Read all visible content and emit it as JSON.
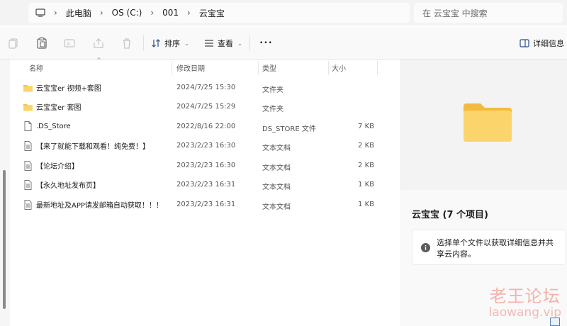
{
  "address": {
    "crumbs": [
      "此电脑",
      "OS (C:)",
      "001",
      "云宝宝"
    ],
    "search_placeholder": "在 云宝宝 中搜索"
  },
  "commands": {
    "sort_label": "排序",
    "view_label": "查看",
    "more_label": "•••",
    "details_label": "详细信息"
  },
  "columns": {
    "name": "名称",
    "modified": "修改日期",
    "type": "类型",
    "size": "大小"
  },
  "files": [
    {
      "name": "云宝宝er 视频+套图",
      "modified": "2024/7/25 15:30",
      "type": "文件夹",
      "size": "",
      "icon": "folder-icon"
    },
    {
      "name": "云宝宝er 套图",
      "modified": "2024/7/25 15:29",
      "type": "文件夹",
      "size": "",
      "icon": "folder-icon"
    },
    {
      "name": ".DS_Store",
      "modified": "2022/8/16 22:00",
      "type": "DS_STORE 文件",
      "size": "7 KB",
      "icon": "file-icon"
    },
    {
      "name": "【来了就能下载和观看！纯免费！】",
      "modified": "2023/2/23 16:30",
      "type": "文本文档",
      "size": "2 KB",
      "icon": "text-file-icon"
    },
    {
      "name": "【论坛介绍】",
      "modified": "2023/2/23 16:30",
      "type": "文本文档",
      "size": "2 KB",
      "icon": "text-file-icon"
    },
    {
      "name": "【永久地址发布页】",
      "modified": "2023/2/23 16:31",
      "type": "文本文档",
      "size": "1 KB",
      "icon": "text-file-icon"
    },
    {
      "name": "最新地址及APP请发邮箱自动获取！！！",
      "modified": "2023/2/23 16:31",
      "type": "文本文档",
      "size": "1 KB",
      "icon": "text-file-icon"
    }
  ],
  "details": {
    "title": "云宝宝 (7 个项目)",
    "info": "选择单个文件以获取详细信息并共享云内容。"
  },
  "watermark": {
    "cn": "老王论坛",
    "url": "laowang.vip"
  }
}
